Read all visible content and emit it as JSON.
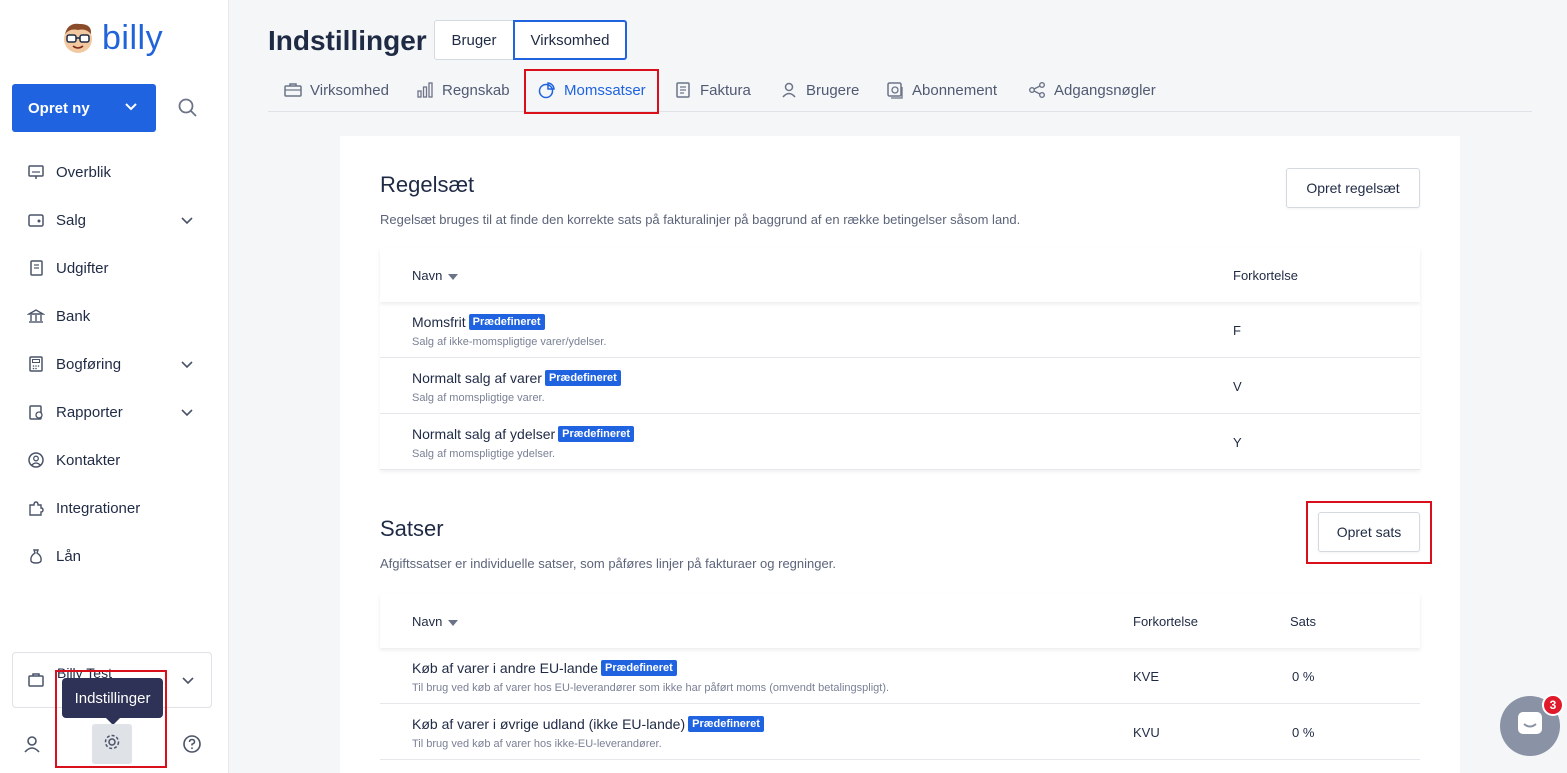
{
  "app": {
    "logo_text": "billy"
  },
  "sidebar": {
    "create_label": "Opret ny",
    "items": [
      {
        "label": "Overblik",
        "icon": "dashboard-icon",
        "has_chevron": false
      },
      {
        "label": "Salg",
        "icon": "wallet-icon",
        "has_chevron": true
      },
      {
        "label": "Udgifter",
        "icon": "receipt-icon",
        "has_chevron": false
      },
      {
        "label": "Bank",
        "icon": "bank-icon",
        "has_chevron": false
      },
      {
        "label": "Bogføring",
        "icon": "calculator-icon",
        "has_chevron": true
      },
      {
        "label": "Rapporter",
        "icon": "report-icon",
        "has_chevron": true
      },
      {
        "label": "Kontakter",
        "icon": "contact-icon",
        "has_chevron": false
      },
      {
        "label": "Integrationer",
        "icon": "puzzle-icon",
        "has_chevron": false
      },
      {
        "label": "Lån",
        "icon": "money-bag-icon",
        "has_chevron": false
      }
    ],
    "org_name": "Billy Test",
    "tooltip": "Indstillinger"
  },
  "header": {
    "title": "Indstillinger",
    "segments": [
      {
        "label": "Bruger",
        "active": false
      },
      {
        "label": "Virksomhed",
        "active": true
      }
    ],
    "tabs": [
      {
        "label": "Virksomhed",
        "icon": "briefcase-icon",
        "active": false
      },
      {
        "label": "Regnskab",
        "icon": "bar-chart-icon",
        "active": false
      },
      {
        "label": "Momssatser",
        "icon": "pie-chart-icon",
        "active": true
      },
      {
        "label": "Faktura",
        "icon": "document-icon",
        "active": false
      },
      {
        "label": "Brugere",
        "icon": "user-icon",
        "active": false
      },
      {
        "label": "Abonnement",
        "icon": "subscription-icon",
        "active": false
      },
      {
        "label": "Adgangsnøgler",
        "icon": "share-nodes-icon",
        "active": false
      }
    ]
  },
  "rulesets": {
    "title": "Regelsæt",
    "description": "Regelsæt bruges til at finde den korrekte sats på fakturalinjer på baggrund af en række betingelser såsom land.",
    "create_label": "Opret regelsæt",
    "columns": {
      "name": "Navn",
      "abbr": "Forkortelse"
    },
    "rows": [
      {
        "name": "Momsfrit",
        "badge": "Prædefineret",
        "sub": "Salg af ikke-momspligtige varer/ydelser.",
        "abbr": "F"
      },
      {
        "name": "Normalt salg af varer",
        "badge": "Prædefineret",
        "sub": "Salg af momspligtige varer.",
        "abbr": "V"
      },
      {
        "name": "Normalt salg af ydelser",
        "badge": "Prædefineret",
        "sub": "Salg af momspligtige ydelser.",
        "abbr": "Y"
      }
    ]
  },
  "rates": {
    "title": "Satser",
    "description": "Afgiftssatser er individuelle satser, som påføres linjer på fakturaer og regninger.",
    "create_label": "Opret sats",
    "columns": {
      "name": "Navn",
      "abbr": "Forkortelse",
      "rate": "Sats"
    },
    "rows": [
      {
        "name": "Køb af varer i andre EU-lande",
        "badge": "Prædefineret",
        "sub": "Til brug ved køb af varer hos EU-leverandører som ikke har påført moms (omvendt betalingspligt).",
        "abbr": "KVE",
        "rate": "0 %"
      },
      {
        "name": "Køb af varer i øvrige udland (ikke EU-lande)",
        "badge": "Prædefineret",
        "sub": "Til brug ved køb af varer hos ikke-EU-leverandører.",
        "abbr": "KVU",
        "rate": "0 %"
      }
    ]
  },
  "chat": {
    "unread_count": "3"
  },
  "colors": {
    "primary": "#1f63e0",
    "highlight": "#d9101c",
    "tooltip_bg": "#2d3256"
  }
}
